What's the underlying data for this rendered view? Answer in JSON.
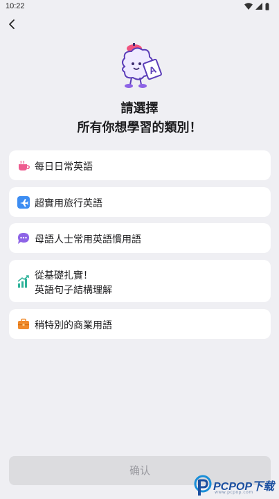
{
  "status_bar": {
    "time": "10:22"
  },
  "header": {
    "title_line1": "請選擇",
    "title_line2": "所有你想學習的類別！"
  },
  "categories": [
    {
      "label": "每日日常英語",
      "icon": "coffee-cup-icon",
      "color": "#ee5a8f"
    },
    {
      "label": "超實用旅行英語",
      "icon": "airplane-icon",
      "color": "#3d8df2"
    },
    {
      "label": "母語人士常用英語慣用語",
      "icon": "chat-bubble-icon",
      "color": "#8d63e6"
    },
    {
      "label_line1": "從基礎扎實！",
      "label_line2": "英語句子結構理解",
      "icon": "growth-chart-icon",
      "color": "#2fb39a"
    },
    {
      "label": "稍特別的商業用語",
      "icon": "briefcase-icon",
      "color": "#f08a2c"
    }
  ],
  "footer": {
    "confirm_label": "确认"
  },
  "watermark": {
    "brand": "PCPOP下载",
    "sub": "www.pcpop.com"
  }
}
